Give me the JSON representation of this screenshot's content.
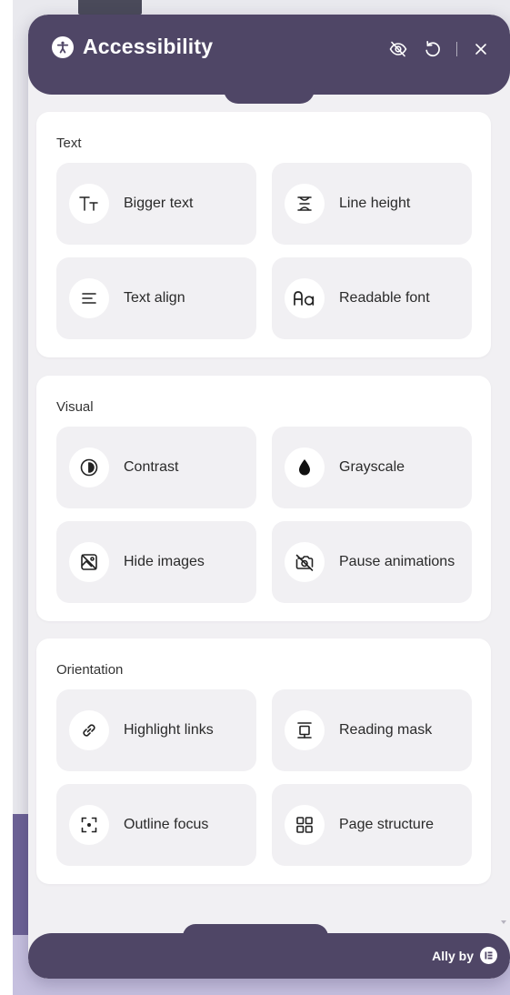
{
  "header": {
    "title": "Accessibility",
    "icons": [
      "accessibility-person-icon",
      "hide-widget-icon",
      "reset-icon",
      "close-icon"
    ]
  },
  "sections": [
    {
      "title": "Text",
      "items": [
        {
          "label": "Bigger text",
          "icon": "bigger-text-icon"
        },
        {
          "label": "Line height",
          "icon": "line-height-icon"
        },
        {
          "label": "Text align",
          "icon": "text-align-icon"
        },
        {
          "label": "Readable font",
          "icon": "readable-font-icon"
        }
      ]
    },
    {
      "title": "Visual",
      "items": [
        {
          "label": "Contrast",
          "icon": "contrast-icon"
        },
        {
          "label": "Grayscale",
          "icon": "grayscale-icon"
        },
        {
          "label": "Hide images",
          "icon": "hide-images-icon"
        },
        {
          "label": "Pause animations",
          "icon": "pause-animations-icon"
        }
      ]
    },
    {
      "title": "Orientation",
      "items": [
        {
          "label": "Highlight links",
          "icon": "highlight-links-icon"
        },
        {
          "label": "Reading mask",
          "icon": "reading-mask-icon"
        },
        {
          "label": "Outline focus",
          "icon": "outline-focus-icon"
        },
        {
          "label": "Page structure",
          "icon": "page-structure-icon"
        }
      ]
    }
  ],
  "footer": {
    "brand": "Ally by",
    "logo_icon": "elementor-logo-icon"
  },
  "colors": {
    "primary": "#4f4666",
    "panel_bg": "#f1f0f3",
    "card_bg": "#ffffff",
    "tile_bg": "#f1f0f3",
    "page_overlay": "#6c6296"
  }
}
